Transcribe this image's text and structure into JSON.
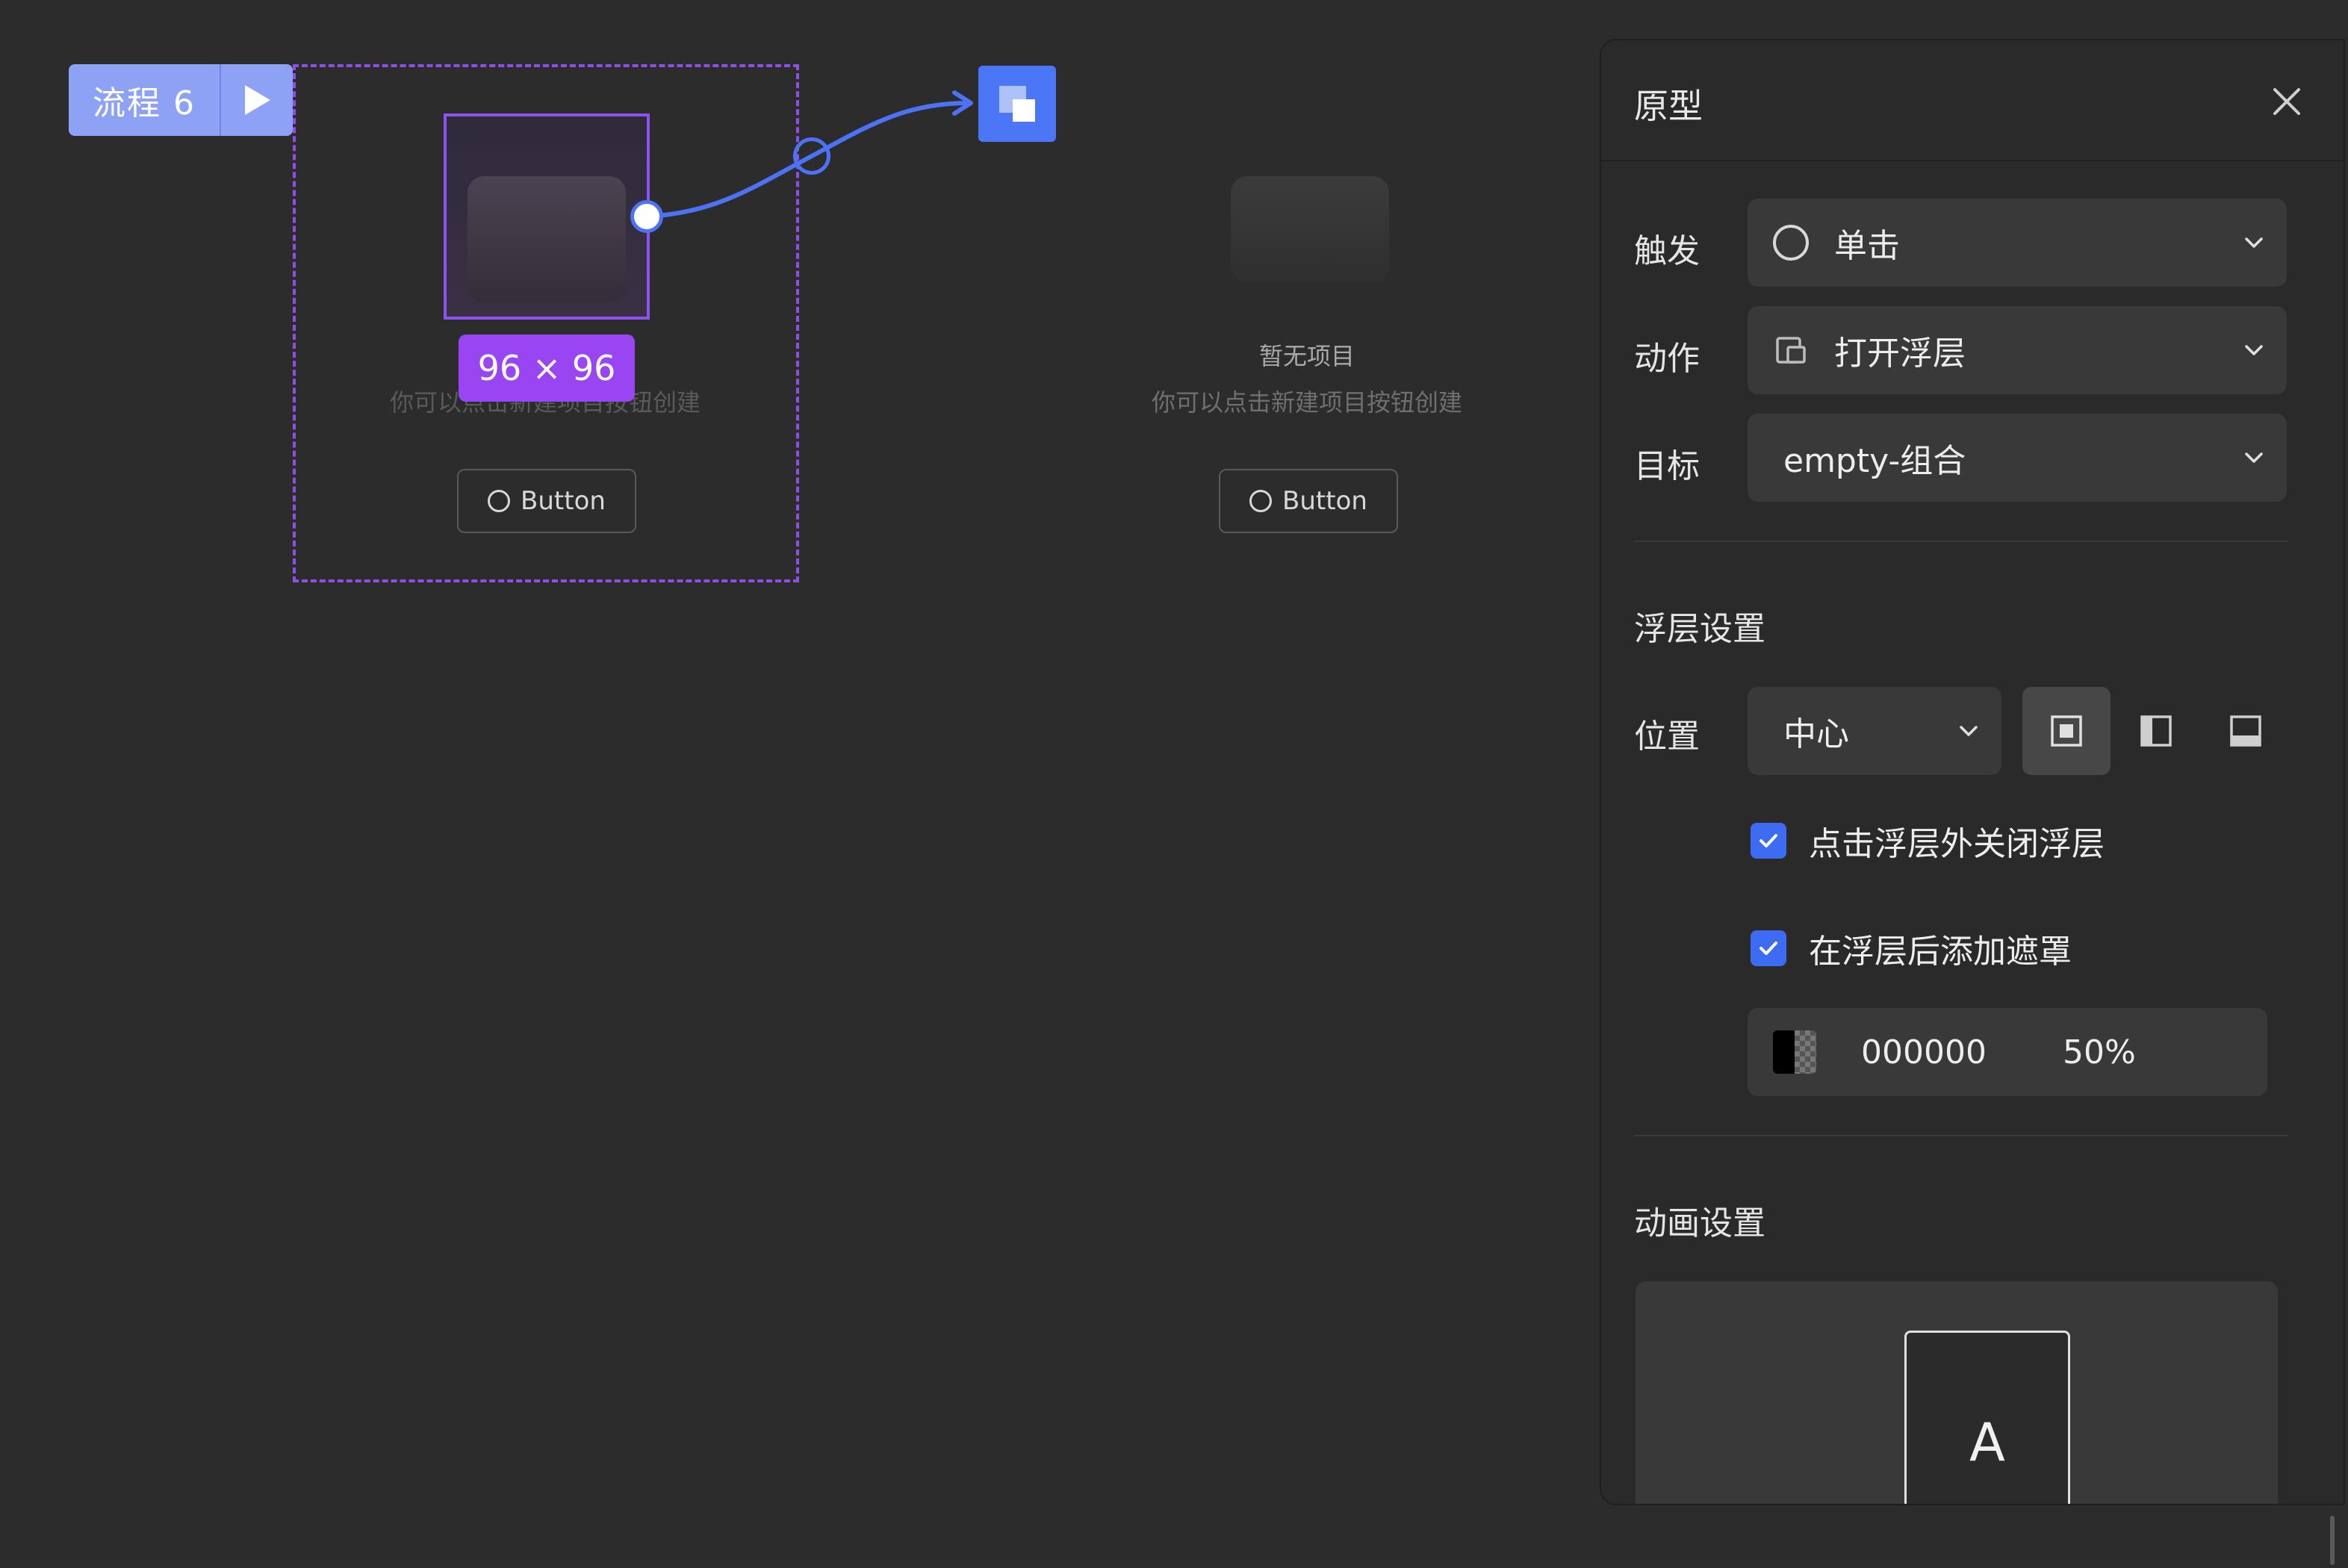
{
  "canvas": {
    "flow_tag": {
      "label": "流程 6"
    },
    "size_badge": "96 × 96",
    "hint_selected": "你可以点击新建项目按钮创建",
    "button_label": "Button",
    "empty_state": {
      "title": "暂无项目",
      "hint": "你可以点击新建项目按钮创建",
      "button_label": "Button"
    },
    "colors": {
      "flow_tag": "#8ea2f5",
      "selection_border": "#8e4fe8",
      "badge": "#9a45f2",
      "connector": "#4d72f5",
      "target_node": "#4b76f6"
    }
  },
  "panel": {
    "title": "原型",
    "close_icon": "close-icon",
    "trigger": {
      "label": "触发",
      "value": "单击",
      "icon": "circle-icon"
    },
    "action": {
      "label": "动作",
      "value": "打开浮层",
      "icon": "overlay-icon"
    },
    "target": {
      "label": "目标",
      "value": "empty-组合"
    },
    "overlay_settings": {
      "title": "浮层设置",
      "position_label": "位置",
      "position_value": "中心",
      "position_options": [
        "center-position-icon",
        "left-position-icon",
        "bottom-position-icon"
      ],
      "close_on_outside_click": {
        "label": "点击浮层外关闭浮层",
        "checked": true
      },
      "add_mask": {
        "label": "在浮层后添加遮罩",
        "checked": true
      },
      "mask_color": "000000",
      "mask_opacity": "50%"
    },
    "animation_settings": {
      "title": "动画设置",
      "preview_letter": "A"
    },
    "colors": {
      "accent": "#3d6cf2",
      "panel_bg": "#2a2a2a",
      "field_bg": "#393939"
    }
  }
}
